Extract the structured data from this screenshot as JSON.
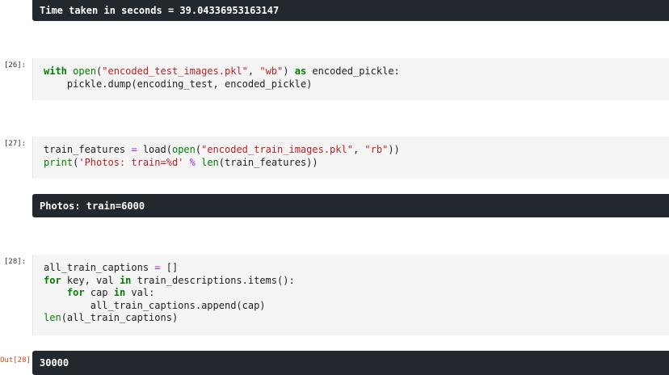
{
  "cells": {
    "out_time": {
      "text": "Time taken in seconds = 39.04336953163147"
    },
    "c26": {
      "prompt": "[26]:",
      "line1": {
        "kw_with": "with",
        "fn_open": "open",
        "p1": "(",
        "s1": "\"encoded_test_images.pkl\"",
        "p2": ", ",
        "s2": "\"wb\"",
        "p3": ") ",
        "kw_as": "as",
        "p4": " encoded_pickle:"
      },
      "line2": "    pickle.dump(encoding_test, encoded_pickle)"
    },
    "c27": {
      "prompt": "[27]:",
      "line1": {
        "a": "train_features ",
        "op": "=",
        "b": " load(",
        "fn_open": "open",
        "c": "(",
        "s1": "\"encoded_train_images.pkl\"",
        "d": ", ",
        "s2": "\"rb\"",
        "e": "))"
      },
      "line2": {
        "fn_print": "print",
        "a": "(",
        "s1": "'Photos: train=%d'",
        "b": " ",
        "op": "%",
        "c": " ",
        "fn_len": "len",
        "d": "(train_features))"
      }
    },
    "out_photos": {
      "text": "Photos: train=6000"
    },
    "c28": {
      "prompt": "[28]:",
      "line1": {
        "a": "all_train_captions ",
        "op": "=",
        "b": " []"
      },
      "line2": {
        "kw_for": "for",
        "a": " key, val ",
        "kw_in": "in",
        "b": " train_descriptions.items():"
      },
      "line3": {
        "indent": "    ",
        "kw_for": "for",
        "a": " cap ",
        "kw_in": "in",
        "b": " val:"
      },
      "line4": "        all_train_captions.append(cap)",
      "line5": {
        "fn_len": "len",
        "a": "(all_train_captions)"
      }
    },
    "out28": {
      "prompt": "Out[28]:",
      "text": "30000"
    }
  }
}
